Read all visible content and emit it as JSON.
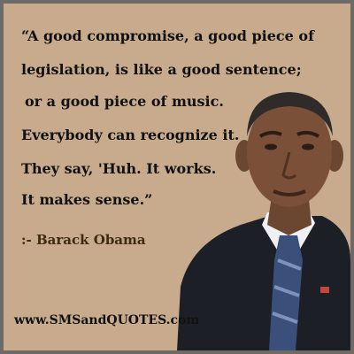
{
  "quote": {
    "lines": [
      "“A good compromise, a good piece of",
      "legislation, is like a good sentence;",
      "or a good piece of music.",
      "Everybody can recognize it.",
      "They say, 'Huh. It works.",
      "It makes sense.”"
    ]
  },
  "author": ":- Barack Obama",
  "website": "www.SMSandQUOTES.com",
  "colors": {
    "background": "#c8ab8d",
    "border": "#6e6a66",
    "text": "#111111",
    "author": "#3d2a0f",
    "suit": "#1d1f26",
    "tie": "#3a4f79"
  }
}
